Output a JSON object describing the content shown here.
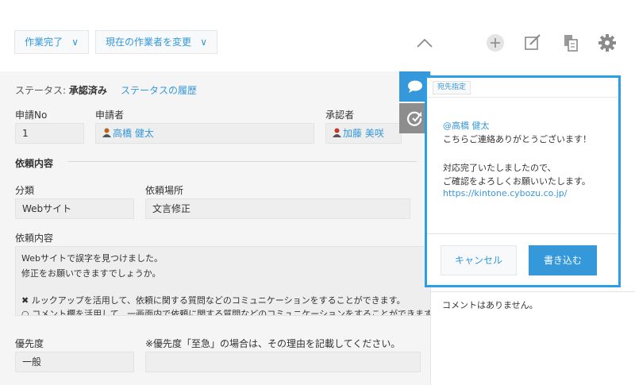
{
  "toolbar": {
    "action_label": "作業完了",
    "assignee_label": "現在の作業者を変更",
    "chevron": "∨",
    "icons": [
      "collapse-icon",
      "add-icon",
      "edit-icon",
      "copy-icon",
      "gear-icon"
    ]
  },
  "status": {
    "label": "ステータス:",
    "value": "承認済み",
    "history_link": "ステータスの履歴"
  },
  "fields": {
    "request_no": {
      "label": "申請No",
      "value": "1"
    },
    "applicant": {
      "label": "申請者",
      "value": "高橋 健太"
    },
    "approver": {
      "label": "承認者",
      "value": "加藤 美咲"
    },
    "section_title": "依頼内容",
    "category": {
      "label": "分類",
      "value": "Webサイト"
    },
    "location": {
      "label": "依頼場所",
      "value": "文言修正"
    },
    "details": {
      "label": "依頼内容",
      "lines": [
        "Webサイトで誤字を見つけました。",
        "修正をお願いできますでしょうか。",
        "",
        "✖ ルックアップを活用して、依頼に関する質問などのコミュニケーションをすることができます。",
        "○ コメント欄を活用して、一画面内で依頼に関する質問などのコミュニケーションをすることができます。"
      ]
    },
    "priority": {
      "label": "優先度",
      "value": "一般"
    },
    "urgent_reason": {
      "label": "※優先度「至急」の場合は、その理由を記載してください。",
      "value": ""
    }
  },
  "comment": {
    "mention_chip": "宛先指定",
    "mention": "@高橋 健太",
    "line1": "こちらご連絡ありがとうございます！",
    "line2": "対応完了いたしましたので、",
    "line3": "ご確認をよろしくお願いいたします。",
    "url": "https://kintone.cybozu.co.jp/",
    "cancel_label": "キャンセル",
    "submit_label": "書き込む",
    "empty_text": "コメントはありません。"
  },
  "colors": {
    "accent": "#3498db",
    "highlight_border": "#2a9fe8",
    "panel_bg": "#f5f5f5",
    "side_tab_active": "#3498db",
    "side_tab_inactive": "#8d8d8d"
  }
}
